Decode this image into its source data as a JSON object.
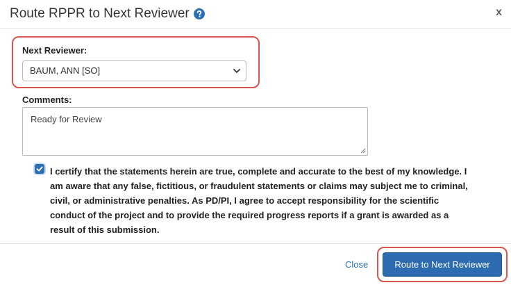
{
  "modal": {
    "title": "Route RPPR to Next Reviewer",
    "help_icon": "question-circle-icon",
    "close_glyph": "x"
  },
  "reviewer": {
    "label": "Next Reviewer:",
    "selected": "BAUM, ANN [SO]"
  },
  "comments": {
    "label": "Comments:",
    "value": "Ready for Review"
  },
  "certification": {
    "checked": true,
    "text": "I certify that the statements herein are true, complete and accurate to the best of my knowledge. I am aware that any false, fictitious, or fraudulent statements or claims may subject me to criminal, civil, or administrative penalties. As PD/PI, I agree to accept responsibility for the scientific conduct of the project and to provide the required progress reports if a grant is awarded as a result of this submission."
  },
  "footer": {
    "close_label": "Close",
    "route_label": "Route to Next Reviewer"
  },
  "colors": {
    "accent": "#2c6bb0",
    "highlight": "#d9534f"
  }
}
